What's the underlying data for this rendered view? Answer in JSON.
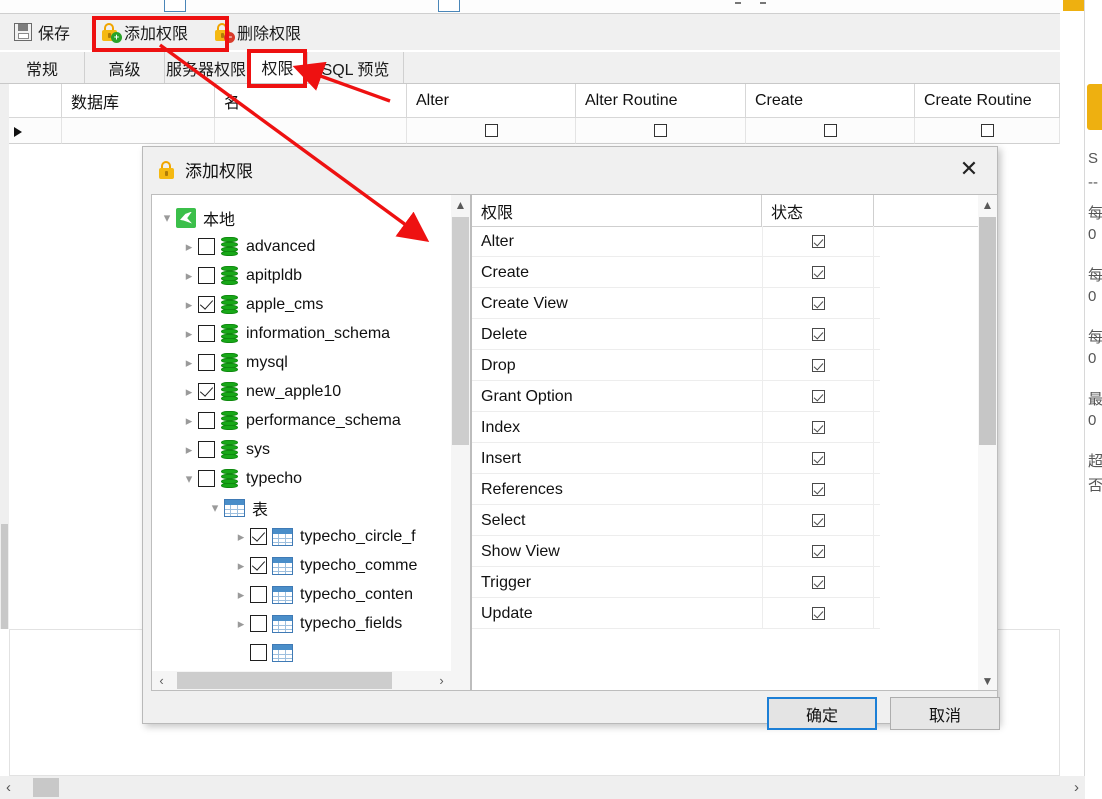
{
  "app": {
    "toolbar": {
      "save_label": "保存",
      "add_privilege_label": "添加权限",
      "delete_privilege_label": "删除权限"
    },
    "tabs": [
      {
        "label": "常规",
        "active": false
      },
      {
        "label": "高级",
        "active": false
      },
      {
        "label": "服务器权限",
        "active": false
      },
      {
        "label": "权限",
        "active": true
      },
      {
        "label": "SQL 预览",
        "active": false
      }
    ],
    "grid": {
      "columns": [
        "",
        "数据库",
        "名",
        "Alter",
        "Alter Routine",
        "Create",
        "Create Routine"
      ],
      "rows": [
        {
          "selected": true,
          "database": "",
          "name": "",
          "alter": false,
          "alter_routine": false,
          "create": false,
          "create_routine": false
        }
      ]
    },
    "side_panel_fragments": [
      "S",
      "--",
      "每",
      "0",
      "每",
      "0",
      "每",
      "0",
      "最",
      "0",
      "超",
      "否"
    ]
  },
  "dialog": {
    "title": "添加权限",
    "close_label": "✕",
    "tree": {
      "root": {
        "label": "本地",
        "icon": "connection-icon",
        "expanded": true
      },
      "nodes": [
        {
          "label": "advanced",
          "icon": "database-icon",
          "checked": false,
          "expanded": false,
          "depth": 1
        },
        {
          "label": "apitpldb",
          "icon": "database-icon",
          "checked": false,
          "expanded": false,
          "depth": 1
        },
        {
          "label": "apple_cms",
          "icon": "database-icon",
          "checked": true,
          "expanded": false,
          "depth": 1
        },
        {
          "label": "information_schema",
          "icon": "database-icon",
          "checked": false,
          "expanded": false,
          "depth": 1
        },
        {
          "label": "mysql",
          "icon": "database-icon",
          "checked": false,
          "expanded": false,
          "depth": 1
        },
        {
          "label": "new_apple10",
          "icon": "database-icon",
          "checked": true,
          "expanded": false,
          "depth": 1
        },
        {
          "label": "performance_schema",
          "icon": "database-icon",
          "checked": false,
          "expanded": false,
          "depth": 1
        },
        {
          "label": "sys",
          "icon": "database-icon",
          "checked": false,
          "expanded": false,
          "depth": 1
        },
        {
          "label": "typecho",
          "icon": "database-icon",
          "checked": false,
          "expanded": true,
          "depth": 1
        },
        {
          "label": "表",
          "icon": "table-group-icon",
          "checked": null,
          "expanded": true,
          "depth": 2
        },
        {
          "label": "typecho_circle_f",
          "icon": "table-icon",
          "checked": true,
          "expanded": false,
          "depth": 3
        },
        {
          "label": "typecho_comme",
          "icon": "table-icon",
          "checked": true,
          "expanded": false,
          "depth": 3
        },
        {
          "label": "typecho_conten",
          "icon": "table-icon",
          "checked": false,
          "expanded": false,
          "depth": 3
        },
        {
          "label": "typecho_fields",
          "icon": "table-icon",
          "checked": false,
          "expanded": false,
          "depth": 3
        }
      ]
    },
    "privileges": {
      "headers": [
        "权限",
        "状态"
      ],
      "rows": [
        {
          "name": "Alter",
          "granted": true
        },
        {
          "name": "Create",
          "granted": true
        },
        {
          "name": "Create View",
          "granted": true
        },
        {
          "name": "Delete",
          "granted": true
        },
        {
          "name": "Drop",
          "granted": true
        },
        {
          "name": "Grant Option",
          "granted": true
        },
        {
          "name": "Index",
          "granted": true
        },
        {
          "name": "Insert",
          "granted": true
        },
        {
          "name": "References",
          "granted": true
        },
        {
          "name": "Select",
          "granted": true
        },
        {
          "name": "Show View",
          "granted": true
        },
        {
          "name": "Trigger",
          "granted": true
        },
        {
          "name": "Update",
          "granted": true
        }
      ]
    },
    "buttons": {
      "ok": "确定",
      "cancel": "取消"
    }
  },
  "annotations": {
    "accent_color": "#ee1111",
    "boxes": [
      "添加权限",
      "权限"
    ],
    "arrows": 2
  }
}
